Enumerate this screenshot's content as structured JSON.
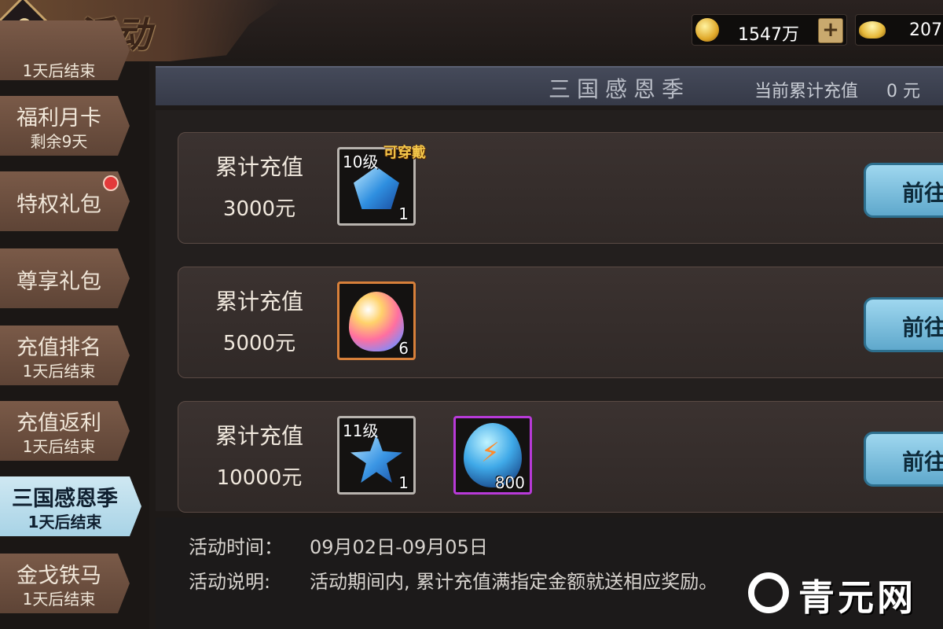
{
  "header": {
    "title": "活动",
    "back_icon": "back-arrow-icon",
    "gold": {
      "icon": "gold-coin-icon",
      "value": "1547万",
      "add_label": "+"
    },
    "ingot": {
      "icon": "ingot-icon",
      "value": "207"
    }
  },
  "sidebar": {
    "items": [
      {
        "name": "",
        "sub": "1天后结束",
        "partial": true
      },
      {
        "name": "福利月卡",
        "sub": "剩余9天"
      },
      {
        "name": "特权礼包",
        "sub": "",
        "badge": "red-dot"
      },
      {
        "name": "尊享礼包",
        "sub": ""
      },
      {
        "name": "充值排名",
        "sub": "1天后结束"
      },
      {
        "name": "充值返利",
        "sub": "1天后结束"
      },
      {
        "name": "三国感恩季",
        "sub": "1天后结束",
        "active": true
      },
      {
        "name": "金戈铁马",
        "sub": "1天后结束"
      }
    ]
  },
  "banner": {
    "title": "三国感恩季",
    "recharge_label": "当前累计充值",
    "recharge_value": "0 元"
  },
  "rewards": [
    {
      "title": "累计充值",
      "amount": "3000元",
      "items": [
        {
          "icon": "blue-pentagon-gem-icon",
          "level": "10级",
          "count": "1",
          "tag": "可穿戴",
          "border": "#b8b3ae"
        }
      ],
      "button": "前往"
    },
    {
      "title": "累计充值",
      "amount": "5000元",
      "items": [
        {
          "icon": "rainbow-gem-icon",
          "count": "6",
          "border": "#d8803a"
        }
      ],
      "button": "前往"
    },
    {
      "title": "累计充值",
      "amount": "10000元",
      "items": [
        {
          "icon": "blue-star-gem-icon",
          "level": "11级",
          "count": "1",
          "border": "#b8b3ae"
        },
        {
          "icon": "lightning-stone-icon",
          "count": "800",
          "border": "#b83ad8"
        }
      ],
      "button": "前往"
    }
  ],
  "info": {
    "time_label": "活动时间：",
    "time_value": "09月02日-09月05日",
    "desc_label": "活动说明:",
    "desc_value": "活动期间内, 累计充值满指定金额就送相应奖励。"
  },
  "watermark": {
    "text": "青元网",
    "icon": "qingyuan-logo-icon"
  }
}
